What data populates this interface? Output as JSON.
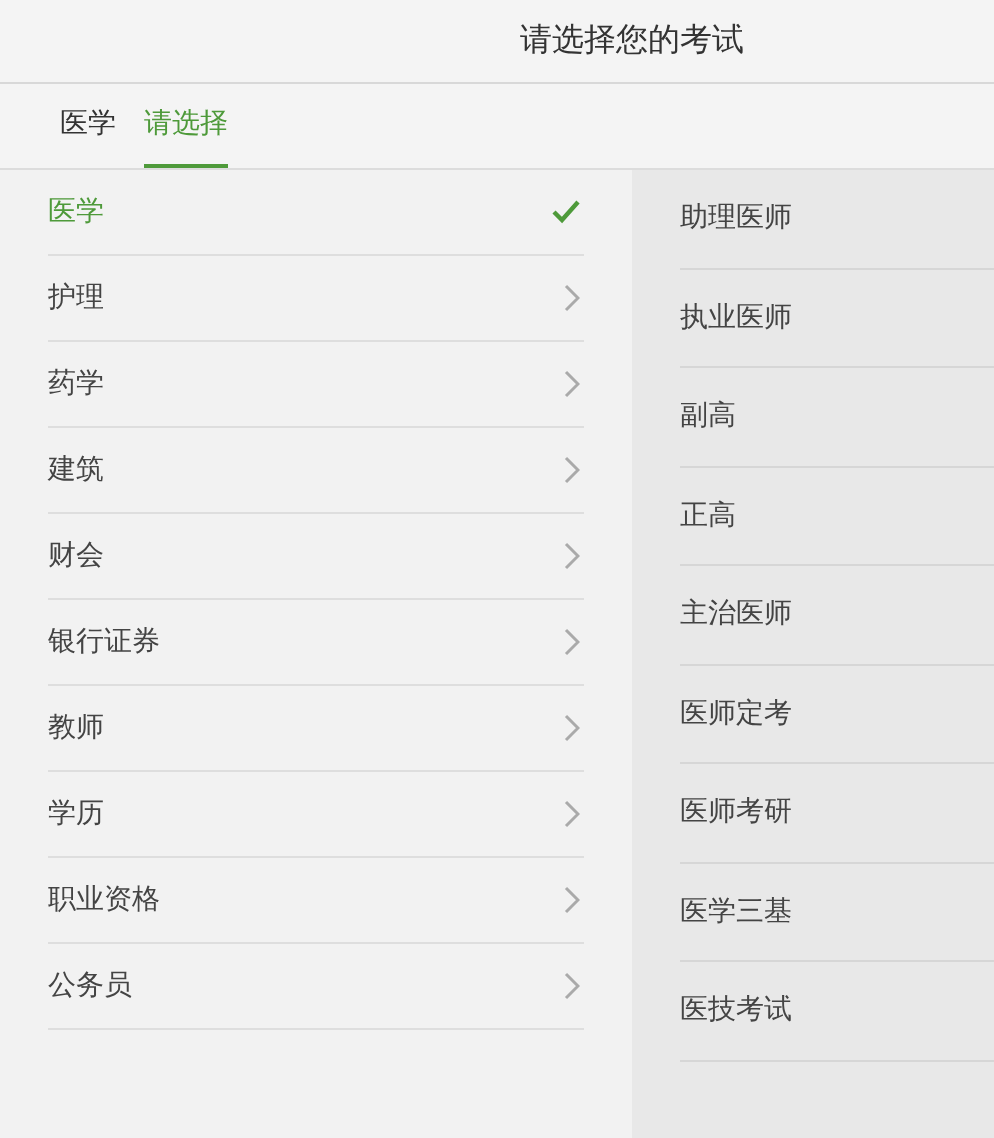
{
  "header": {
    "title": "请选择您的考试"
  },
  "tabs": [
    {
      "label": "医学",
      "selected": false
    },
    {
      "label": "请选择",
      "selected": true
    }
  ],
  "categories": [
    {
      "label": "医学",
      "selected": true
    },
    {
      "label": "护理",
      "selected": false
    },
    {
      "label": "药学",
      "selected": false
    },
    {
      "label": "建筑",
      "selected": false
    },
    {
      "label": "财会",
      "selected": false
    },
    {
      "label": "银行证券",
      "selected": false
    },
    {
      "label": "教师",
      "selected": false
    },
    {
      "label": "学历",
      "selected": false
    },
    {
      "label": "职业资格",
      "selected": false
    },
    {
      "label": "公务员",
      "selected": false
    }
  ],
  "exams": [
    "助理医师",
    "执业医师",
    "副高",
    "正高",
    "主治医师",
    "医师定考",
    "医师考研",
    "医学三基",
    "医技考试"
  ]
}
